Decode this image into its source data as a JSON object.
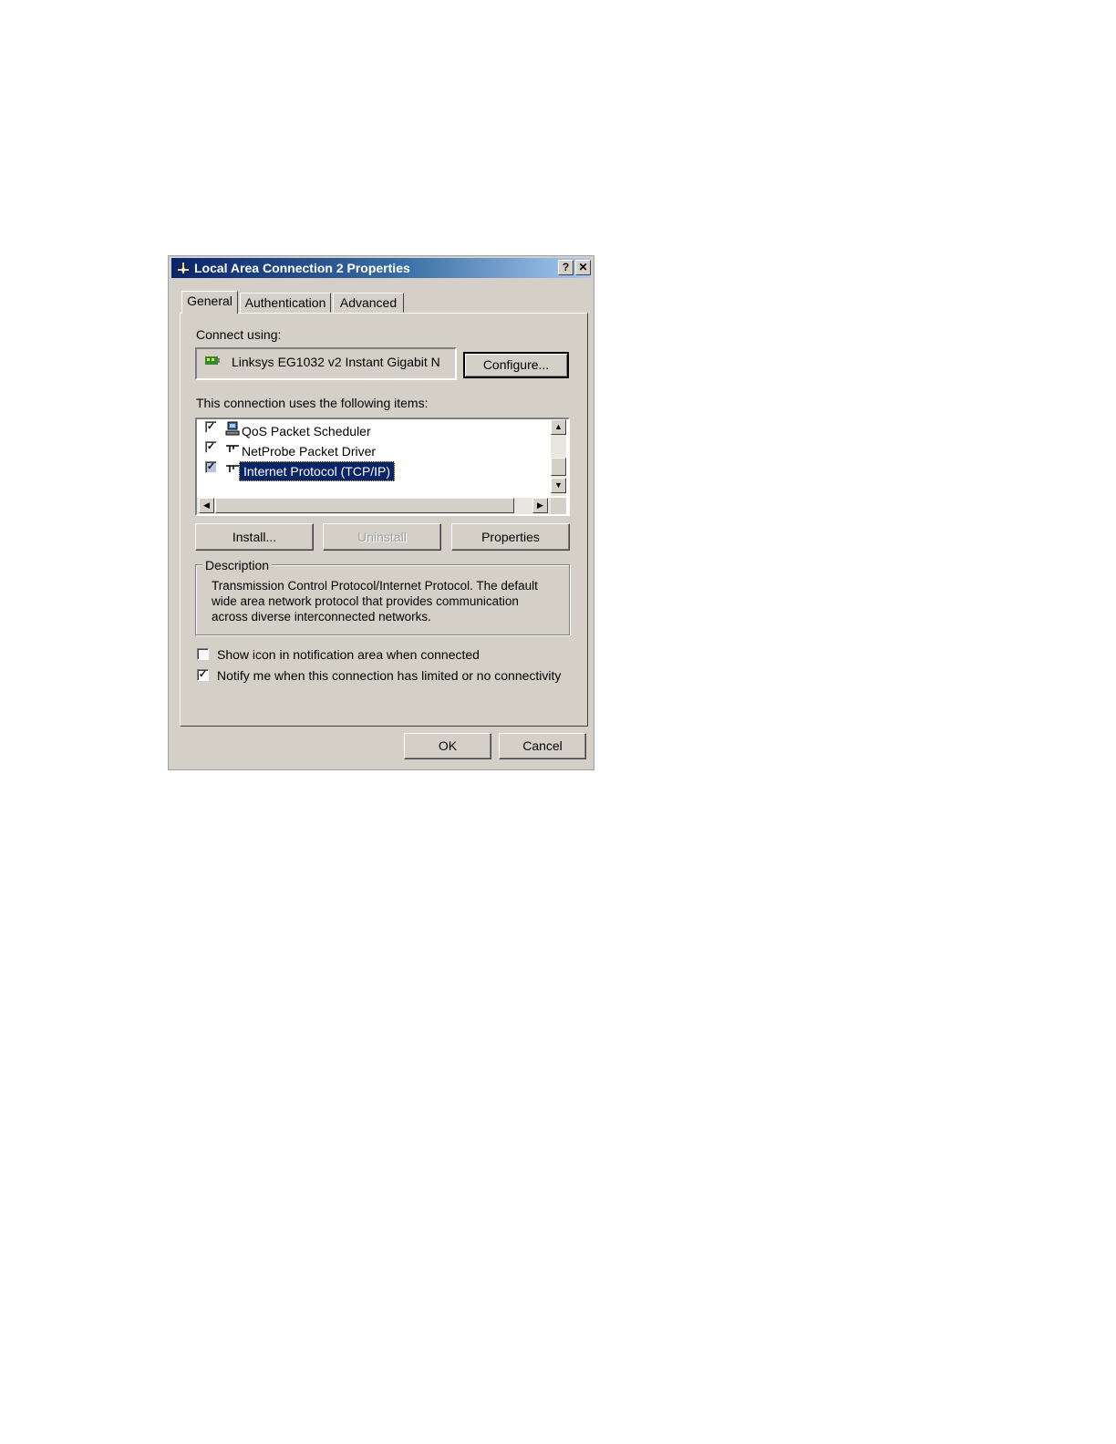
{
  "dialog": {
    "title": "Local Area Connection 2 Properties",
    "help_glyph": "?",
    "close_glyph": "✕"
  },
  "tabs": [
    {
      "label": "General",
      "active": true
    },
    {
      "label": "Authentication",
      "active": false
    },
    {
      "label": "Advanced",
      "active": false
    }
  ],
  "connect": {
    "label": "Connect using:",
    "adapter": "Linksys EG1032 v2 Instant Gigabit N",
    "configure_button": "Configure..."
  },
  "items": {
    "label": "This connection uses the following items:",
    "list": [
      {
        "label": "QoS Packet Scheduler",
        "checked": true,
        "icon": "scheduler-icon"
      },
      {
        "label": "NetProbe Packet Driver",
        "checked": true,
        "icon": "protocol-icon"
      },
      {
        "label": "Internet Protocol (TCP/IP)",
        "checked": true,
        "icon": "protocol-icon",
        "selected": true
      }
    ],
    "check_glyph": "✓"
  },
  "buttons": {
    "install": "Install...",
    "uninstall": "Uninstall",
    "properties": "Properties"
  },
  "description": {
    "legend": "Description",
    "lines": [
      "Transmission Control Protocol/Internet Protocol. The default",
      "wide area network protocol that provides communication",
      "across diverse interconnected networks."
    ]
  },
  "options": {
    "show_icon": {
      "label": "Show icon in notification area when connected",
      "checked": false
    },
    "notify": {
      "label": "Notify me when this connection has limited or no connectivity",
      "checked": true
    }
  },
  "footer": {
    "ok": "OK",
    "cancel": "Cancel"
  },
  "colors": {
    "selection": "#0a246a",
    "title_start": "#0a246a",
    "title_end": "#a6caf0",
    "face": "#d4d0c8"
  }
}
